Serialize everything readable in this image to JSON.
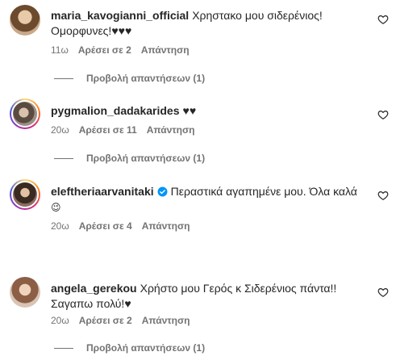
{
  "comments": [
    {
      "username": "maria_kavogianni_official",
      "text_line1": "Χρηστακο μου σιδερένιος!",
      "text_line2": "Ομορφυνες!♥♥♥",
      "time": "11ω",
      "likes": "Αρέσει σε 2",
      "reply": "Απάντηση",
      "view_replies": "Προβολή απαντήσεων (1)"
    },
    {
      "username": "pygmalion_dadakarides",
      "text_line1": "♥♥",
      "time": "20ω",
      "likes": "Αρέσει σε 11",
      "reply": "Απάντηση",
      "view_replies": "Προβολή απαντήσεων (1)"
    },
    {
      "username": "eleftheriaarvanitaki",
      "text_line1": "Περαστικά αγαπημένε μου. Όλα καλά",
      "text_line2": "😉",
      "time": "20ω",
      "likes": "Αρέσει σε 4",
      "reply": "Απάντηση"
    },
    {
      "username": "angela_gerekou",
      "text_line1": "Χρήστο μου Γερός κ Σιδερένιος πάντα!!",
      "text_line2": "Σαγαπω πολύ!♥",
      "time": "20ω",
      "likes": "Αρέσει σε 2",
      "reply": "Απάντηση",
      "view_replies": "Προβολή απαντήσεων (1)"
    }
  ],
  "icons": {
    "like": "heart-outline-icon",
    "verified": "verified-badge-icon"
  },
  "colors": {
    "text": "#262626",
    "secondary": "#737373",
    "verified": "#0095f6"
  }
}
